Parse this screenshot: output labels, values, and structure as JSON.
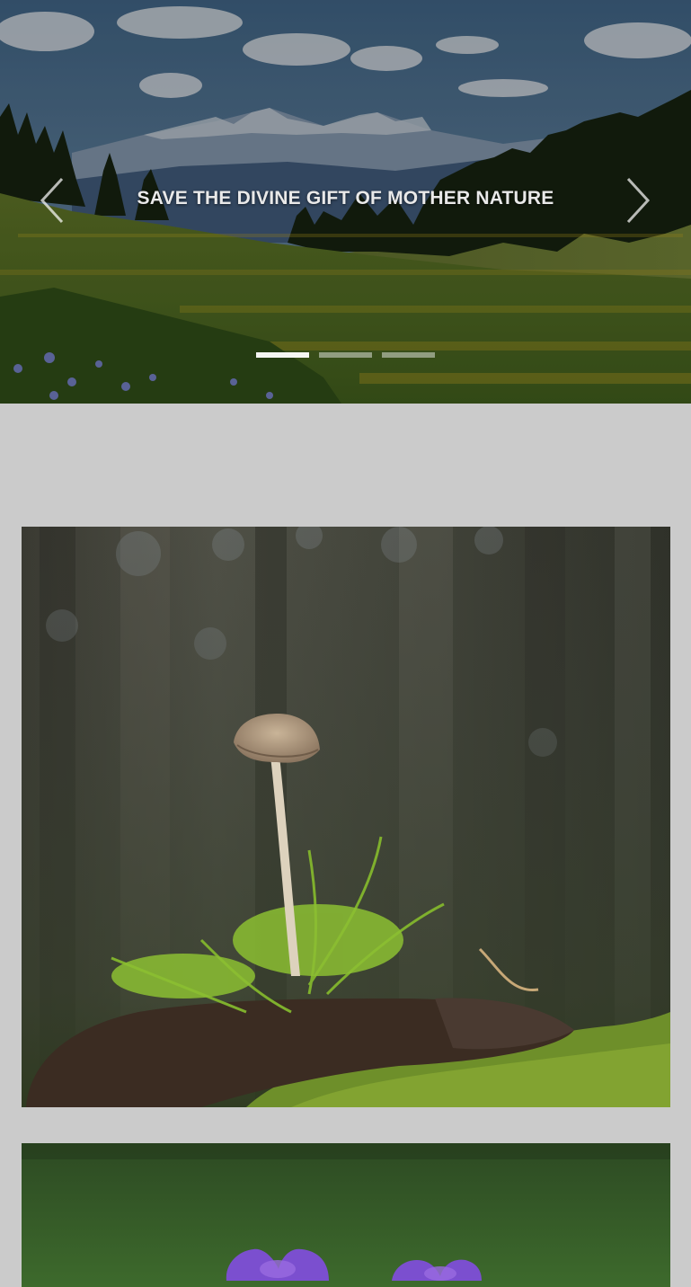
{
  "carousel": {
    "caption": "SAVE THE DIVINE GIFT OF MOTHER NATURE",
    "prev_icon": "chevron-left-icon",
    "next_icon": "chevron-right-icon",
    "indicators": [
      {
        "active": true
      },
      {
        "active": false
      },
      {
        "active": false
      }
    ]
  },
  "gallery": {
    "images": [
      {
        "subject": "mushroom-on-moss-in-forest"
      },
      {
        "subject": "purple-crocus-flowers"
      }
    ]
  },
  "colors": {
    "page_background": "#cbcbcb",
    "caption_text": "#e9e9e9"
  }
}
